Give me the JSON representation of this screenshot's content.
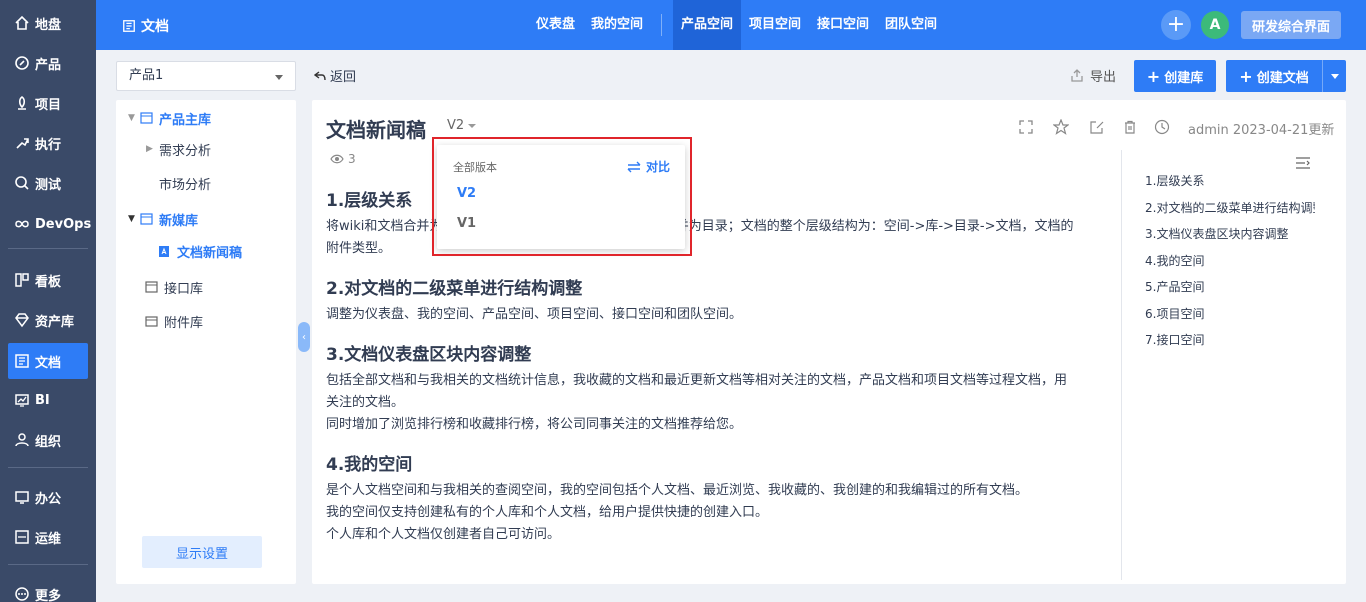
{
  "left_nav": {
    "items": [
      {
        "label": "地盘",
        "icon": "home-icon"
      },
      {
        "label": "产品",
        "icon": "product-icon"
      },
      {
        "label": "项目",
        "icon": "project-icon"
      },
      {
        "label": "执行",
        "icon": "execution-icon"
      },
      {
        "label": "测试",
        "icon": "test-icon"
      },
      {
        "label": "DevOps",
        "icon": "devops-icon"
      },
      {
        "label": "看板",
        "icon": "kanban-icon"
      },
      {
        "label": "资产库",
        "icon": "asset-icon"
      },
      {
        "label": "文档",
        "icon": "doc-icon",
        "active": true
      },
      {
        "label": "BI",
        "icon": "bi-icon"
      },
      {
        "label": "组织",
        "icon": "org-icon"
      },
      {
        "label": "办公",
        "icon": "office-icon"
      },
      {
        "label": "运维",
        "icon": "ops-icon"
      },
      {
        "label": "更多",
        "icon": "more-icon"
      }
    ]
  },
  "topbar": {
    "title": "文档",
    "nav": [
      "仪表盘",
      "我的空间",
      "产品空间",
      "项目空间",
      "接口空间",
      "团队空间"
    ],
    "active_nav": "产品空间",
    "avatar_letter": "A",
    "space_label": "研发综合界面"
  },
  "toolbar": {
    "product_select": "产品1",
    "back_label": "返回",
    "export_label": "导出",
    "create_lib_label": "创建库",
    "create_doc_label": "创建文档"
  },
  "tree": {
    "product_lib": "产品主库",
    "req_analysis": "需求分析",
    "market_analysis": "市场分析",
    "new_media_lib": "新媒库",
    "doc_news": "文档新闻稿",
    "api_lib": "接口库",
    "attach_lib": "附件库",
    "display_settings": "显示设置"
  },
  "doc": {
    "title": "文档新闻稿",
    "version": "V2",
    "views": "3",
    "meta": "admin 2023-04-21更新",
    "sections": {
      "s1_title": "1.层级关系",
      "s1_p1": "将wiki和文档合并为文档，将原来wiki和文档的目录和分类合并为目录；文档的整个层级结构为：空间->库->目录->文档，文档的",
      "s1_p2": "附件类型。",
      "s2_title": "2.对文档的二级菜单进行结构调整",
      "s2_p1": "调整为仪表盘、我的空间、产品空间、项目空间、接口空间和团队空间。",
      "s3_title": "3.文档仪表盘区块内容调整",
      "s3_p1": "包括全部文档和与我相关的文档统计信息，我收藏的文档和最近更新文档等相对关注的文档，产品文档和项目文档等过程文档，用",
      "s3_p2": "关注的文档。",
      "s3_p3": "同时增加了浏览排行榜和收藏排行榜，将公司同事关注的文档推荐给您。",
      "s4_title": "4.我的空间",
      "s4_p1": "是个人文档空间和与我相关的查阅空间，我的空间包括个人文档、最近浏览、我收藏的、我创建的和我编辑过的所有文档。",
      "s4_p2": "我的空间仅支持创建私有的个人库和个人文档，给用户提供快捷的创建入口。",
      "s4_p3": "个人库和个人文档仅创建者自己可访问。"
    }
  },
  "toc": [
    "1.层级关系",
    "2.对文档的二级菜单进行结构调整",
    "3.文档仪表盘区块内容调整",
    "4.我的空间",
    "5.产品空间",
    "6.项目空间",
    "7.接口空间"
  ],
  "version_dropdown": {
    "header": "全部版本",
    "compare_label": "对比",
    "items": [
      "V2",
      "V1"
    ],
    "selected": "V2"
  },
  "colors": {
    "primary": "#2e7cf6",
    "nav_bg": "#3a4a68",
    "highlight_box": "#e0252b"
  }
}
